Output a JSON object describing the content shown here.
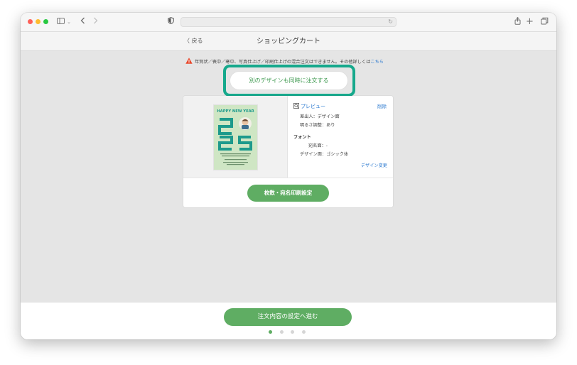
{
  "browser": {
    "address_text": "",
    "icons": [
      "sidebar-icon",
      "chevron-down-icon",
      "back-arrow-icon",
      "forward-arrow-icon",
      "privacy-shield-icon",
      "reload-icon",
      "share-icon",
      "plus-icon",
      "tabs-icon"
    ]
  },
  "header": {
    "back_label": "〈 戻る",
    "title": "ショッピングカート"
  },
  "warning": {
    "text": "年賀状／喪中／寒中、写真仕上げ／印刷仕上げの混合注文はできません。その他詳しくは",
    "link_label": "こちら",
    "icon": "warning-triangle-icon",
    "icon_color": "#e8472b"
  },
  "order_another_label": "別のデザインも同時に注文する",
  "highlight_color": "#16a98c",
  "card": {
    "preview_label": "プレビュー",
    "delete_label": "削除",
    "sender_row": "差出人：デザイン面",
    "brightness_row": "明るさ調整：あり",
    "font_heading": "フォント",
    "addressee_row": "宛名面：-",
    "design_font_row": "デザイン面：ゴシック体",
    "design_change_label": "デザイン変更",
    "print_button_label": "枚数・宛名印刷設定",
    "image": {
      "headline": "HAPPY NEW YEAR",
      "year_digits": "25"
    }
  },
  "footer": {
    "proceed_label": "注文内容の設定へ進む",
    "step_current": 1,
    "step_total": 4
  },
  "colors": {
    "accent_green": "#5fad63",
    "link_blue": "#2e7bd0"
  }
}
